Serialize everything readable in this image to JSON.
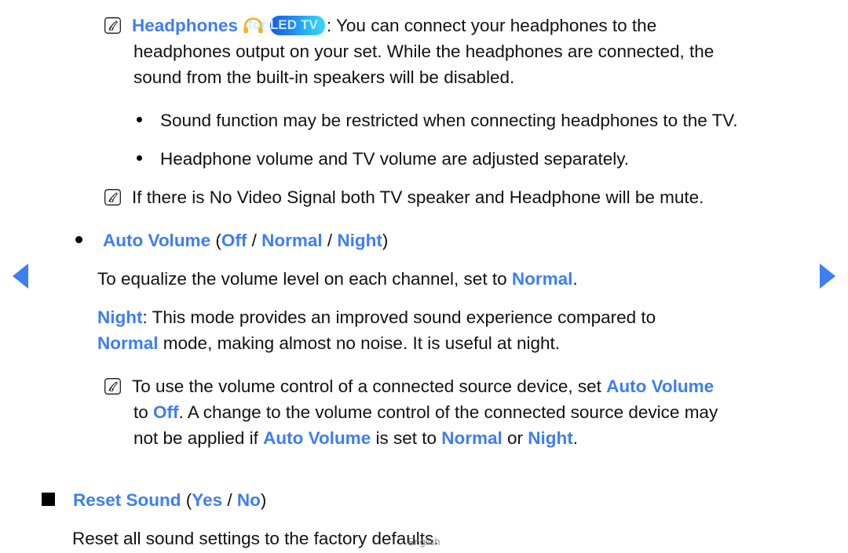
{
  "colors": {
    "accent_blue": "#3d7ef3",
    "text_black": "#111111",
    "badge_gradient_start": "#0f5fe8",
    "badge_gradient_end": "#38d8f7",
    "badge_text": "#cfe8fb",
    "headphone_icon": "#f0b323",
    "footer_text": "#8c8c8c"
  },
  "nav": {
    "prev_label": "Previous page",
    "next_label": "Next page"
  },
  "icons": {
    "note": "note-icon",
    "headphones": "headphones-icon",
    "bullet": "bullet-dot-icon",
    "square": "bullet-square-icon",
    "prev": "arrow-left-icon",
    "next": "arrow-right-icon"
  },
  "content": {
    "headphones_note": {
      "title": "Headphones",
      "badge": "for LED TV",
      "body_1": ": You can connect your headphones to the",
      "body_2": "headphones output on your set. While the headphones are connected, the",
      "body_3": "sound from the built-in speakers will be disabled."
    },
    "sub_bullets": [
      "Sound function may be restricted when connecting headphones to the TV.",
      "Headphone volume and TV volume are adjusted separately."
    ],
    "no_signal_note": "If there is No Video Signal both TV speaker and Headphone will be mute.",
    "auto_volume": {
      "title": "Auto Volume",
      "paren_open": "(",
      "option_1": "Off",
      "sep_1": " / ",
      "option_2": "Normal",
      "sep_2": " / ",
      "option_3": "Night",
      "paren_close": ")"
    },
    "equalize_line": {
      "pre": "To equalize the volume level on each channel, set to ",
      "hl": "Normal",
      "post": "."
    },
    "night_desc": {
      "hl_1": "Night",
      "text_1": ": This mode provides an improved sound experience compared to",
      "hl_2": "Normal",
      "text_2": " mode, making almost no noise. It is useful at night."
    },
    "auto_volume_note": {
      "line1_pre": "To use the volume control of a connected source device, set ",
      "line1_hl": "Auto Volume",
      "line2_pre": "to ",
      "line2_hl": "Off",
      "line2_post": ". A change to the volume control of the connected source device may",
      "line3_pre": "not be applied if ",
      "line3_hl_1": "Auto Volume",
      "line3_mid_1": " is set to ",
      "line3_hl_2": "Normal",
      "line3_mid_2": " or ",
      "line3_hl_3": "Night",
      "line3_post": "."
    },
    "reset_sound": {
      "title": "Reset Sound",
      "paren_open": "(",
      "option_1": "Yes",
      "sep_1": " / ",
      "option_2": "No",
      "paren_close": ")",
      "description": "Reset all sound settings to the factory defaults."
    }
  },
  "footer": {
    "language": "English"
  }
}
